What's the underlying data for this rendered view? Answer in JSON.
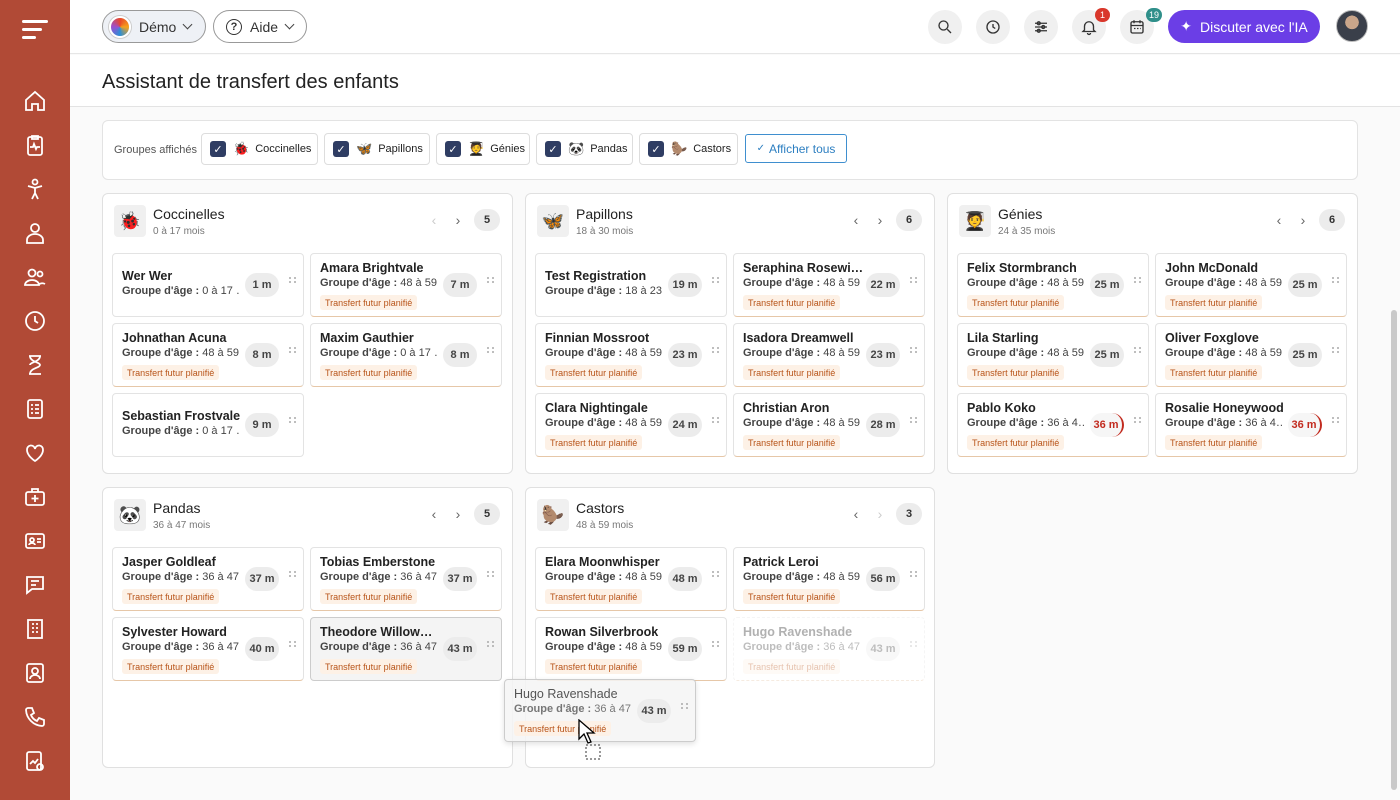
{
  "topbar": {
    "demo_label": "Démo",
    "help_label": "Aide",
    "notifications_count": "1",
    "calendar_count": "19",
    "ai_label": "Discuter avec l'IA"
  },
  "page": {
    "title": "Assistant de transfert des enfants"
  },
  "filter": {
    "label": "Groupes affichés",
    "chips": [
      {
        "label": "Coccinelles",
        "emoji": "🐞"
      },
      {
        "label": "Papillons",
        "emoji": "🦋"
      },
      {
        "label": "Génies",
        "emoji": "🧑‍🎓"
      },
      {
        "label": "Pandas",
        "emoji": "🐼"
      },
      {
        "label": "Castors",
        "emoji": "🦫"
      }
    ],
    "show_all": "Afficher tous"
  },
  "labels": {
    "age_prefix": "Groupe d'âge :",
    "transfer_tag": "Transfert futur planifié"
  },
  "groups": [
    {
      "name": "Coccinelles",
      "emoji": "🐞",
      "age": "0 à 17 mois",
      "count": "5",
      "children": [
        {
          "name": "Wer Wer",
          "age": "0 à 17 …",
          "time": "1 m",
          "tag": false
        },
        {
          "name": "Amara Brightvale",
          "age": "48 à 59 …",
          "time": "7 m",
          "tag": true
        },
        {
          "name": "Johnathan Acuna",
          "age": "48 à 59 …",
          "time": "8 m",
          "tag": true
        },
        {
          "name": "Maxim Gauthier",
          "age": "0 à 17 …",
          "time": "8 m",
          "tag": true
        },
        {
          "name": "Sebastian Frostvale",
          "age": "0 à 17 …",
          "time": "9 m",
          "tag": false
        }
      ]
    },
    {
      "name": "Papillons",
      "emoji": "🦋",
      "age": "18 à 30 mois",
      "count": "6",
      "children": [
        {
          "name": "Test Registration",
          "age": "18 à 23…",
          "time": "19 m",
          "tag": false
        },
        {
          "name": "Seraphina Rosewi…",
          "age": "48 à 59…",
          "time": "22 m",
          "tag": true
        },
        {
          "name": "Finnian Mossroot",
          "age": "48 à 59…",
          "time": "23 m",
          "tag": true
        },
        {
          "name": "Isadora Dreamwell",
          "age": "48 à 59…",
          "time": "23 m",
          "tag": true
        },
        {
          "name": "Clara Nightingale",
          "age": "48 à 59…",
          "time": "24 m",
          "tag": true
        },
        {
          "name": "Christian Aron",
          "age": "48 à 59…",
          "time": "28 m",
          "tag": true
        }
      ]
    },
    {
      "name": "Génies",
      "emoji": "🧑‍🎓",
      "age": "24 à 35 mois",
      "count": "6",
      "children": [
        {
          "name": "Felix Stormbranch",
          "age": "48 à 59…",
          "time": "25 m",
          "tag": true
        },
        {
          "name": "John McDonald",
          "age": "48 à 59…",
          "time": "25 m",
          "tag": true
        },
        {
          "name": "Lila Starling",
          "age": "48 à 59…",
          "time": "25 m",
          "tag": true
        },
        {
          "name": "Oliver Foxglove",
          "age": "48 à 59…",
          "time": "25 m",
          "tag": true
        },
        {
          "name": "Pablo Koko",
          "age": "36 à 4…",
          "time": "36 m",
          "tag": true,
          "alert": true
        },
        {
          "name": "Rosalie Honeywood",
          "age": "36 à 4…",
          "time": "36 m",
          "tag": true,
          "alert": true
        }
      ]
    },
    {
      "name": "Pandas",
      "emoji": "🐼",
      "age": "36 à 47 mois",
      "count": "5",
      "children": [
        {
          "name": "Jasper Goldleaf",
          "age": "36 à 47…",
          "time": "37 m",
          "tag": true
        },
        {
          "name": "Tobias Emberstone",
          "age": "36 à 47…",
          "time": "37 m",
          "tag": true
        },
        {
          "name": "Sylvester Howard",
          "age": "36 à 47…",
          "time": "40 m",
          "tag": true
        },
        {
          "name": "Theodore Willow…",
          "age": "36 à 47…",
          "time": "43 m",
          "tag": true
        }
      ]
    },
    {
      "name": "Castors",
      "emoji": "🦫",
      "age": "48 à 59 mois",
      "count": "3",
      "children": [
        {
          "name": "Elara Moonwhisper",
          "age": "48 à 59…",
          "time": "48 m",
          "tag": true
        },
        {
          "name": "Patrick Leroi",
          "age": "48 à 59…",
          "time": "56 m",
          "tag": true
        },
        {
          "name": "Rowan Silverbrook",
          "age": "48 à 59…",
          "time": "59 m",
          "tag": true
        },
        {
          "name": "Hugo Ravenshade",
          "age": "36 à 47…",
          "time": "43 m",
          "tag": true
        }
      ]
    }
  ],
  "drag": {
    "name": "Hugo Ravenshade",
    "age": "36 à 47…",
    "time": "43 m"
  }
}
